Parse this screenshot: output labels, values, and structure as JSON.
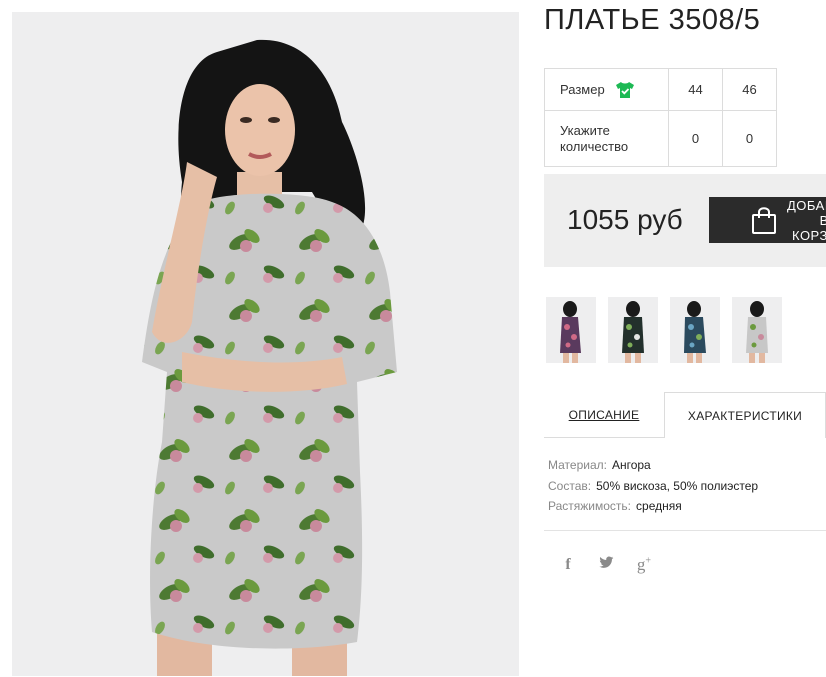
{
  "product": {
    "title": "ПЛАТЬЕ 3508/5"
  },
  "sizes": {
    "size_label": "Размер",
    "qty_label": "Укажите количество",
    "options": [
      {
        "size": "44",
        "qty": "0"
      },
      {
        "size": "46",
        "qty": "0"
      }
    ]
  },
  "purchase": {
    "price": "1055 руб",
    "add_button_label": "ДОБАВИТЬ В КОРЗИНУ"
  },
  "tabs": [
    {
      "label": "ОПИСАНИЕ",
      "active": false
    },
    {
      "label": "ХАРАКТЕРИСТИКИ",
      "active": true
    }
  ],
  "specs": [
    {
      "key": "Материал:",
      "value": "Ангора"
    },
    {
      "key": "Состав:",
      "value": "50% вискоза, 50% полиэстер"
    },
    {
      "key": "Растяжимость:",
      "value": "средняя"
    }
  ],
  "colors": {
    "accent_green": "#1db954",
    "button_dark": "#2b2b2b",
    "price_bg": "#eeeeee"
  },
  "thumbnails": [
    {
      "icon": "dress-thumbnail-pink-floral"
    },
    {
      "icon": "dress-thumbnail-green-floral"
    },
    {
      "icon": "dress-thumbnail-blue-floral"
    },
    {
      "icon": "dress-thumbnail-grey-floral"
    }
  ],
  "social_icons": [
    "facebook-icon",
    "twitter-icon",
    "google-plus-icon"
  ]
}
